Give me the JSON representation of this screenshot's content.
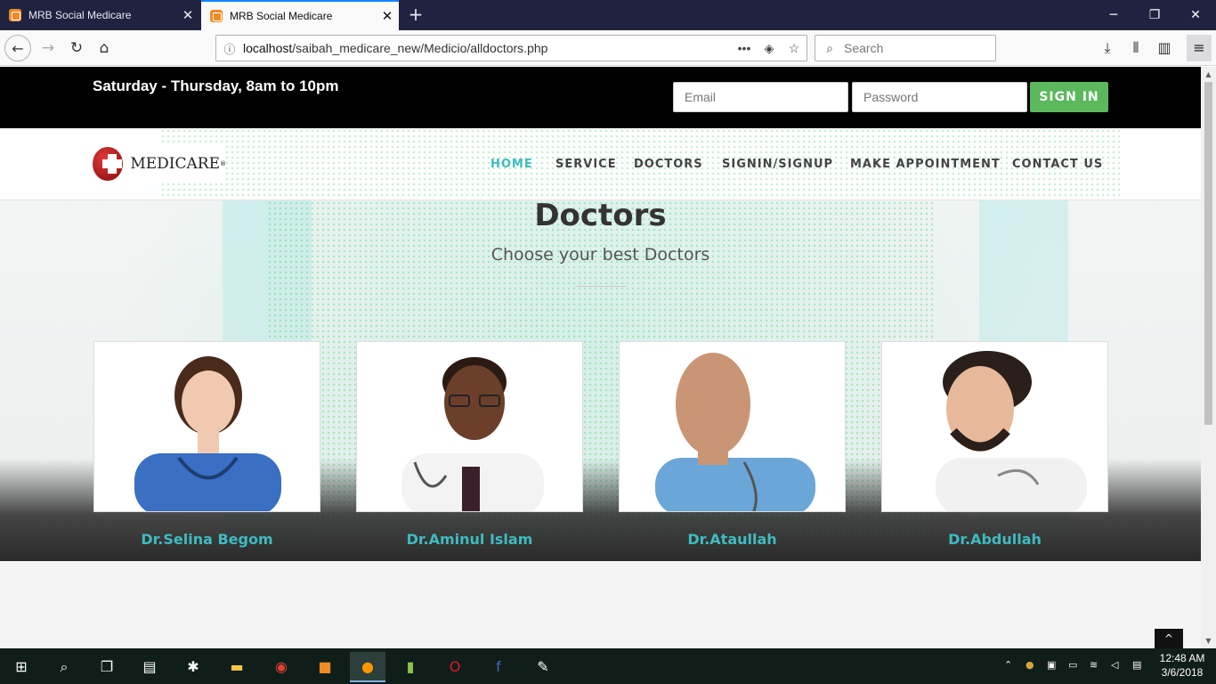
{
  "browser": {
    "tabs": [
      {
        "title": "MRB Social Medicare",
        "active": false
      },
      {
        "title": "MRB Social Medicare",
        "active": true
      }
    ],
    "url_host": "localhost",
    "url_path": "/saibah_medicare_new/Medicio/alldoctors.php",
    "search_placeholder": "Search",
    "page_actions": "•••"
  },
  "topbar": {
    "hours": "Saturday - Thursday, 8am to 10pm",
    "email_placeholder": "Email",
    "password_placeholder": "Password",
    "signin_label": "SIGN IN"
  },
  "header": {
    "logo_text": "MEDICARE",
    "logo_mark": "®",
    "nav": [
      {
        "label": "HOME",
        "current": true
      },
      {
        "label": "SERVICE",
        "current": false
      },
      {
        "label": "DOCTORS",
        "current": false
      },
      {
        "label": "SIGNIN/SIGNUP",
        "current": false
      },
      {
        "label": "MAKE APPOINTMENT",
        "current": false
      },
      {
        "label": "CONTACT US",
        "current": false
      }
    ]
  },
  "section": {
    "title": "Doctors",
    "subtitle": "Choose your best Doctors"
  },
  "doctors": [
    {
      "name": "Dr.Selina Begom",
      "scrub": "#3a6fc4",
      "skin": "#f1c9b0",
      "hair": "#4a2a1a"
    },
    {
      "name": "Dr.Aminul Islam",
      "scrub": "#f3f3f3",
      "skin": "#6b3f2a",
      "hair": "#2a1a12"
    },
    {
      "name": "Dr.Ataullah",
      "scrub": "#6aa6d8",
      "skin": "#c99574",
      "hair": "#c99574"
    },
    {
      "name": "Dr.Abdullah",
      "scrub": "#f1f1f1",
      "skin": "#e7b89a",
      "hair": "#2a1f1a"
    }
  ],
  "colors": {
    "accent": "#3fbbc0",
    "signin": "#5cb85c"
  },
  "taskbar": {
    "time": "12:48 AM",
    "date": "3/6/2018"
  }
}
